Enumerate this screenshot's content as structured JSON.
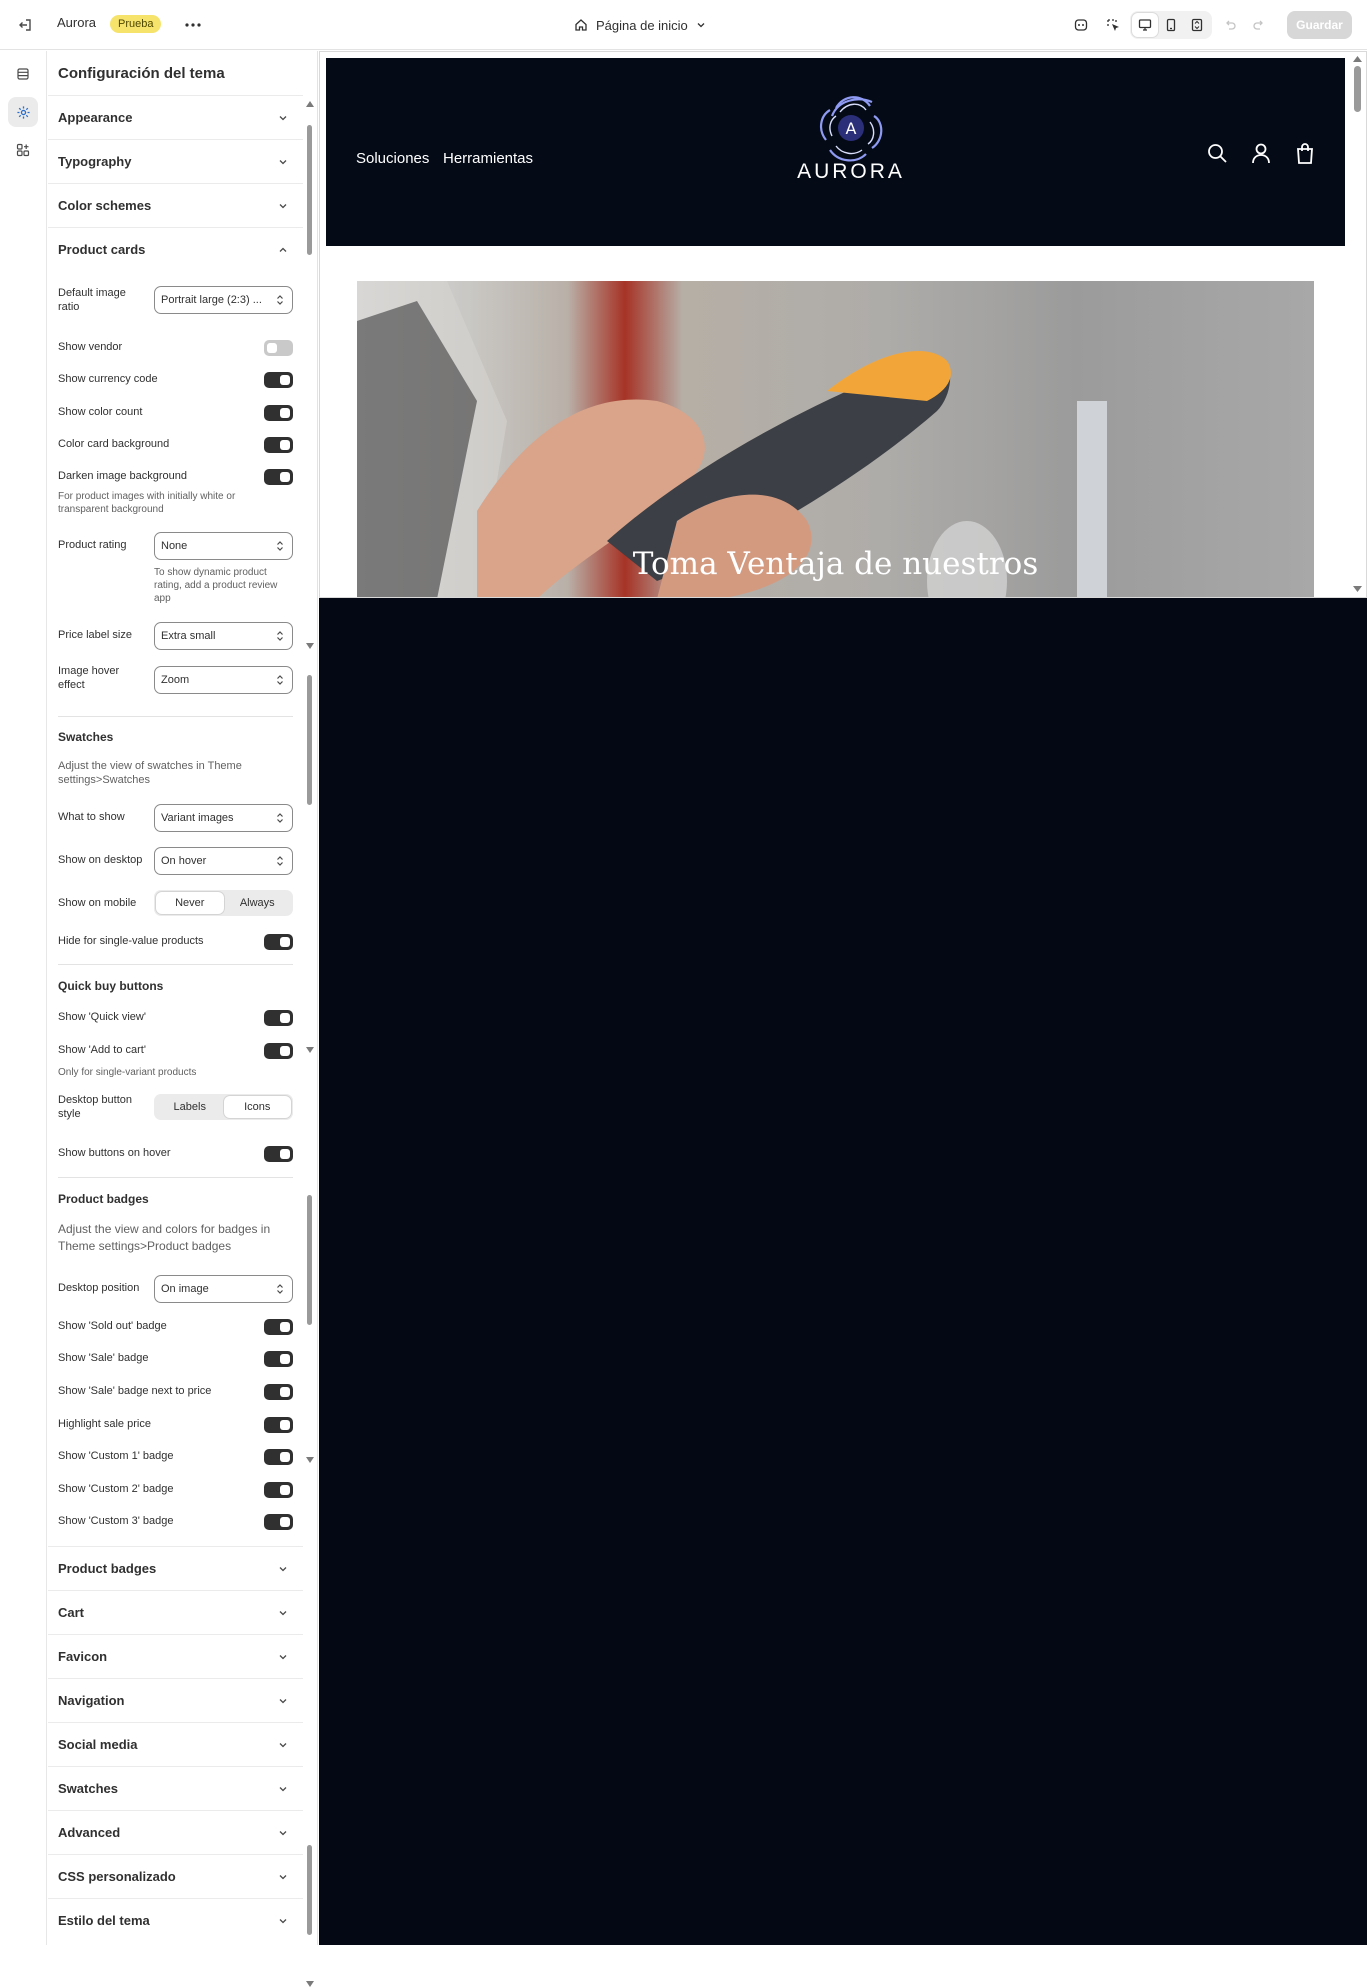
{
  "topbar": {
    "store_name": "Aurora",
    "store_badge": "Prueba",
    "page_selector": "Página de inicio",
    "save_label": "Guardar",
    "icons": [
      "exit-icon",
      "more-icon",
      "home-icon",
      "chevron-down-icon",
      "ai-icon",
      "inspector-icon",
      "desktop-icon",
      "mobile-icon",
      "fullscreen-icon",
      "undo-icon",
      "redo-icon"
    ]
  },
  "rail": {
    "icons": [
      "sections-icon",
      "theme-settings-icon",
      "apps-icon"
    ],
    "active": "theme-settings-icon"
  },
  "panel": {
    "title": "Configuración del tema",
    "sections_top": [
      "Appearance",
      "Typography",
      "Color schemes"
    ],
    "open_section": "Product cards",
    "image_ratio": {
      "label": "Default image ratio",
      "value": "Portrait large (2:3) ..."
    },
    "show_vendor": {
      "label": "Show vendor",
      "on": false
    },
    "show_currency_code": {
      "label": "Show currency code",
      "on": true
    },
    "show_color_count": {
      "label": "Show color count",
      "on": true
    },
    "color_card_background": {
      "label": "Color card background",
      "on": true
    },
    "darken_image_background": {
      "label": "Darken image background",
      "on": true,
      "help": "For product images with initially white or transparent background"
    },
    "product_rating": {
      "label": "Product rating",
      "value": "None",
      "help": "To show dynamic product rating, add a product review app"
    },
    "price_label_size": {
      "label": "Price label size",
      "value": "Extra small"
    },
    "image_hover_effect": {
      "label": "Image hover effect",
      "value": "Zoom"
    },
    "swatches": {
      "title": "Swatches",
      "help": "Adjust the view of swatches in Theme settings>Swatches",
      "what_to_show": {
        "label": "What to show",
        "value": "Variant images"
      },
      "show_on_desktop": {
        "label": "Show on desktop",
        "value": "On hover"
      },
      "show_on_mobile": {
        "label": "Show on mobile",
        "options": [
          "Never",
          "Always"
        ],
        "selected": "Never"
      },
      "hide_single": {
        "label": "Hide for single-value products",
        "on": true
      }
    },
    "quick_buy": {
      "title": "Quick buy buttons",
      "quick_view": {
        "label": "Show 'Quick view'",
        "on": true
      },
      "add_to_cart": {
        "label": "Show 'Add to cart'",
        "on": true,
        "help": "Only for single-variant products"
      },
      "button_style": {
        "label": "Desktop button style",
        "options": [
          "Labels",
          "Icons"
        ],
        "selected": "Icons"
      },
      "buttons_on_hover": {
        "label": "Show buttons on hover",
        "on": true
      }
    },
    "badges": {
      "title": "Product badges",
      "help": "Adjust the view and colors for badges in Theme settings>Product badges",
      "desktop_position": {
        "label": "Desktop position",
        "value": "On image"
      },
      "sold_out": {
        "label": "Show 'Sold out' badge",
        "on": true
      },
      "sale": {
        "label": "Show 'Sale' badge",
        "on": true
      },
      "sale_next_price": {
        "label": "Show 'Sale' badge next to price",
        "on": true
      },
      "highlight_sale": {
        "label": "Highlight sale price",
        "on": true
      },
      "custom1": {
        "label": "Show 'Custom 1' badge",
        "on": true
      },
      "custom2": {
        "label": "Show 'Custom 2' badge",
        "on": true
      },
      "custom3": {
        "label": "Show 'Custom 3' badge",
        "on": true
      }
    },
    "sections_bottom": [
      "Product badges",
      "Cart",
      "Favicon",
      "Navigation",
      "Social media",
      "Swatches",
      "Advanced",
      "CSS personalizado",
      "Estilo del tema"
    ]
  },
  "preview": {
    "nav": [
      "Soluciones",
      "Herramientas"
    ],
    "logo_text": "AURORA",
    "logo_letter": "A",
    "hero_title": "Toma Ventaja de nuestros",
    "header_icons": [
      "search-icon",
      "account-icon",
      "cart-icon"
    ]
  },
  "colors": {
    "toggle_on": "#303030",
    "toggle_off": "#c9c9c9",
    "badge_bg": "#f5e36b",
    "store_header": "#040a16",
    "preview_bg": "#040814"
  }
}
